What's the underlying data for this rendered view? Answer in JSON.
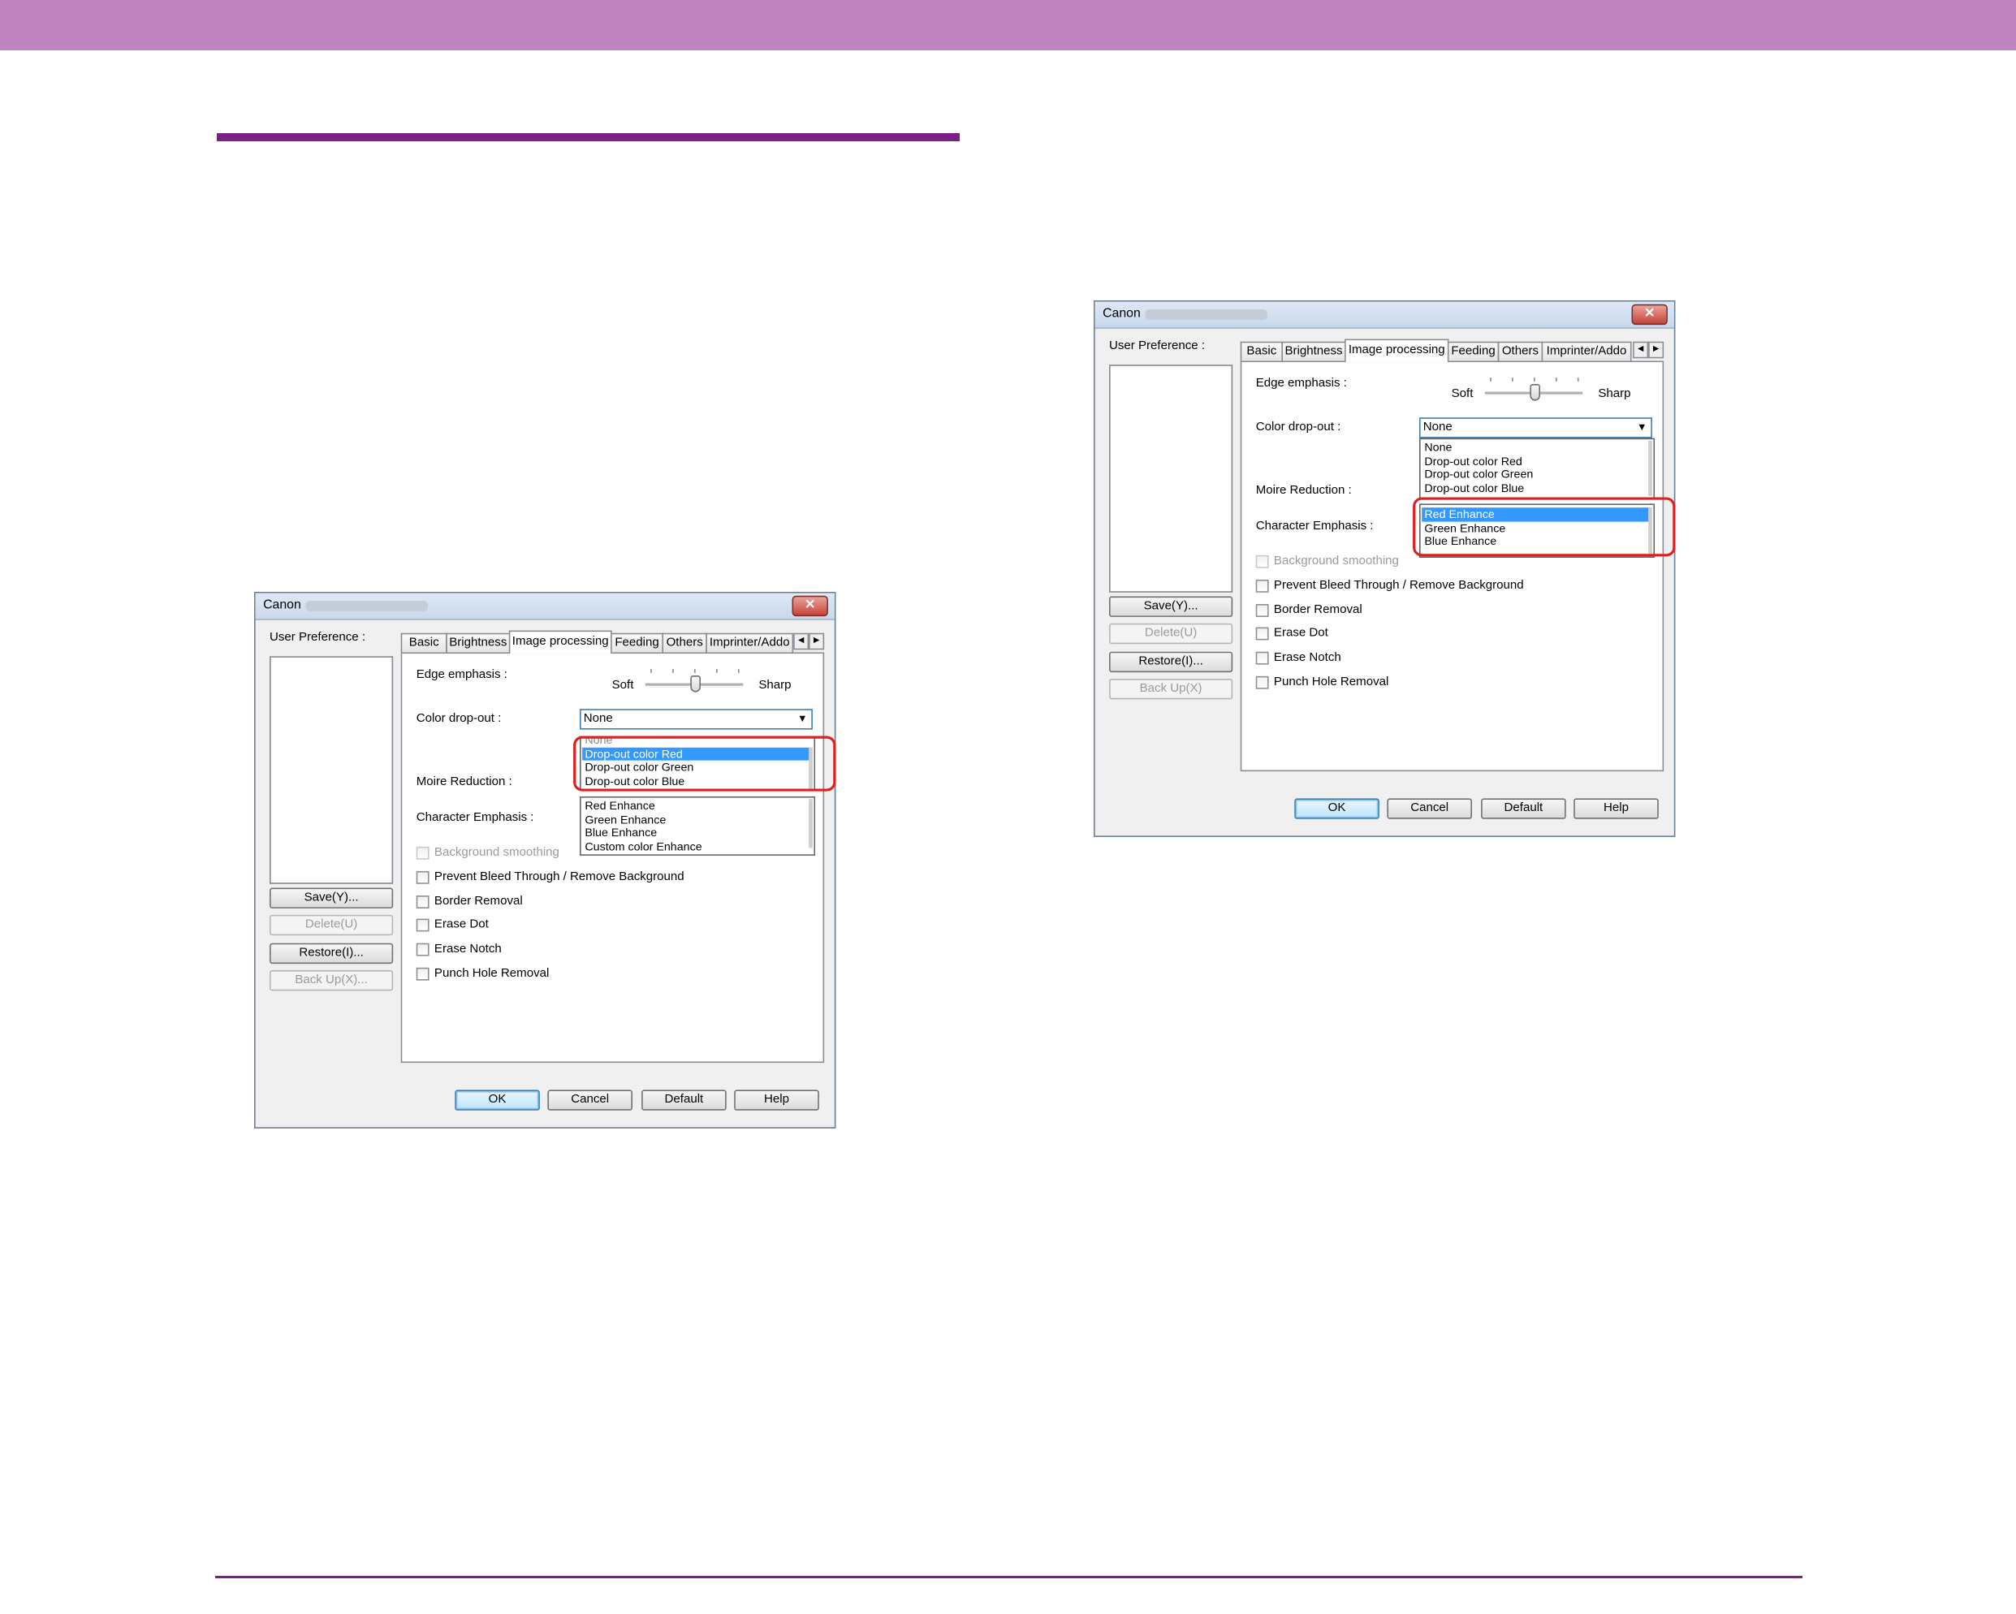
{
  "dialogs": [
    {
      "title": "Canon",
      "user_preference_label": "User Preference :",
      "buttons": {
        "save": "Save(Y)...",
        "delete": "Delete(U)",
        "restore": "Restore(I)...",
        "backup": "Back Up(X)...",
        "ok": "OK",
        "cancel": "Cancel",
        "default": "Default",
        "help": "Help"
      },
      "tabs": [
        "Basic",
        "Brightness",
        "Image processing",
        "Feeding",
        "Others",
        "Imprinter/Addo"
      ],
      "active_tab": "Image processing",
      "edge_emphasis_label": "Edge emphasis :",
      "slider_soft": "Soft",
      "slider_sharp": "Sharp",
      "color_dropout_label": "Color drop-out :",
      "color_dropout_value": "None",
      "moire_label": "Moire Reduction :",
      "char_emphasis_label": "Character Emphasis :",
      "dropdown_upper": [
        "None",
        "Drop-out color Red",
        "Drop-out color Green",
        "Drop-out color Blue"
      ],
      "dropdown_lower": [
        "Red Enhance",
        "Green Enhance",
        "Blue Enhance",
        "Custom color Enhance"
      ],
      "selected_item": "Drop-out color Red",
      "checkboxes": [
        {
          "label": "Background smoothing",
          "enabled": false
        },
        {
          "label": "Prevent Bleed Through / Remove Background",
          "enabled": true
        },
        {
          "label": "Border Removal",
          "enabled": true
        },
        {
          "label": "Erase Dot",
          "enabled": true
        },
        {
          "label": "Erase Notch",
          "enabled": true
        },
        {
          "label": "Punch Hole Removal",
          "enabled": true
        }
      ],
      "highlight_color": "#e02020"
    },
    {
      "title": "Canon",
      "user_preference_label": "User Preference :",
      "buttons": {
        "save": "Save(Y)...",
        "delete": "Delete(U)",
        "restore": "Restore(I)...",
        "backup": "Back Up(X)",
        "ok": "OK",
        "cancel": "Cancel",
        "default": "Default",
        "help": "Help"
      },
      "tabs": [
        "Basic",
        "Brightness",
        "Image processing",
        "Feeding",
        "Others",
        "Imprinter/Addo"
      ],
      "active_tab": "Image processing",
      "edge_emphasis_label": "Edge emphasis :",
      "slider_soft": "Soft",
      "slider_sharp": "Sharp",
      "color_dropout_label": "Color drop-out :",
      "color_dropout_value": "None",
      "moire_label": "Moire Reduction :",
      "char_emphasis_label": "Character Emphasis :",
      "dropdown_upper": [
        "None",
        "Drop-out color Red",
        "Drop-out color Green",
        "Drop-out color Blue"
      ],
      "dropdown_lower": [
        "Red Enhance",
        "Green Enhance",
        "Blue Enhance"
      ],
      "selected_item": "Red Enhance",
      "checkboxes": [
        {
          "label": "Background smoothing",
          "enabled": false
        },
        {
          "label": "Prevent Bleed Through / Remove Background",
          "enabled": true
        },
        {
          "label": "Border Removal",
          "enabled": true
        },
        {
          "label": "Erase Dot",
          "enabled": true
        },
        {
          "label": "Erase Notch",
          "enabled": true
        },
        {
          "label": "Punch Hole Removal",
          "enabled": true
        }
      ],
      "highlight_color": "#e02020"
    }
  ]
}
